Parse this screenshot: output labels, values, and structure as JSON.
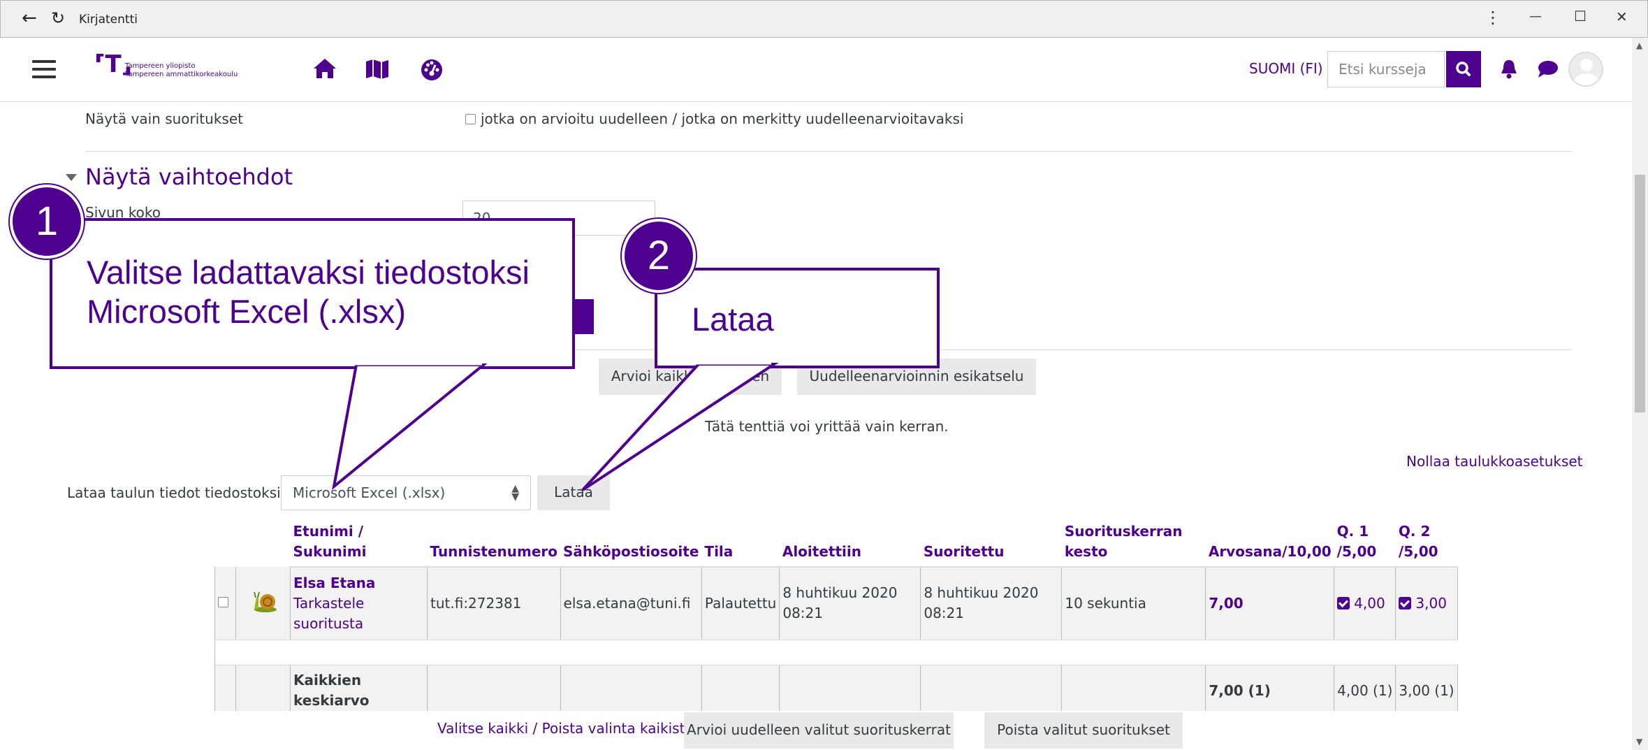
{
  "window": {
    "title": "Kirjatentti",
    "back_icon": "arrow-left-icon",
    "reload_icon": "reload-icon",
    "menu_glyph": "⋮",
    "minimize_glyph": "—",
    "maximize_glyph": "☐",
    "close_glyph": "✕"
  },
  "navbar": {
    "logo_line1": "Tampereen yliopisto",
    "logo_line2": "Tampereen ammattikorkeakoulu",
    "language": "SUOMI (FI)",
    "search_placeholder": "Etsi kursseja",
    "brand_color": "#4e008e"
  },
  "filters": {
    "show_only_label": "Näytä vain suoritukset",
    "regraded_checkbox_label": "jotka on arvioitu uudelleen / jotka on merkitty uudelleenarvioitavaksi"
  },
  "options": {
    "heading": "Näytä vaihtoehdot",
    "page_size_label": "Sivun koko",
    "page_size_value": "20"
  },
  "actions": {
    "regrade_all": "Arvioi kaikki uudelleen",
    "regrade_preview": "Uudelleenarvioinnin esikatselu",
    "attempts_info": "Tätä tenttiä voi yrittää vain kerran.",
    "reset_table": "Nollaa taulukkoasetukset",
    "download_label": "Lataa taulun tiedot tiedostoksi:",
    "download_format": "Microsoft Excel (.xlsx)",
    "download_button": "Lataa"
  },
  "table": {
    "headers": {
      "name": "Etunimi / Sukunimi",
      "idnumber": "Tunnistenumero",
      "email": "Sähköpostiosoite",
      "state": "Tila",
      "started": "Aloitettiin",
      "completed": "Suoritettu",
      "duration": "Suorituskerran kesto",
      "grade": "Arvosana/10,00",
      "q1": "Q. 1 /5,00",
      "q2": "Q. 2 /5,00"
    },
    "rows": [
      {
        "name": "Elsa Etana",
        "review": "Tarkastele suoritusta",
        "idnumber": "tut.fi:272381",
        "email": "elsa.etana@tuni.fi",
        "state": "Palautettu",
        "started": "8 huhtikuu 2020 08:21",
        "completed": "8 huhtikuu 2020 08:21",
        "duration": "10 sekuntia",
        "grade": "7,00",
        "q1": "4,00",
        "q2": "3,00"
      }
    ],
    "average": {
      "label": "Kaikkien keskiarvo",
      "grade": "7,00 (1)",
      "q1": "4,00 (1)",
      "q2": "3,00 (1)"
    }
  },
  "bottom": {
    "select_all": "Valitse kaikki / Poista valinta kaikista",
    "regrade_selected": "Arvioi uudelleen valitut suorituskerrat",
    "delete_selected": "Poista valitut suoritukset"
  },
  "callouts": [
    {
      "number": "1",
      "text": "Valitse ladattavaksi tiedostoksi Microsoft Excel (.xlsx)"
    },
    {
      "number": "2",
      "text": "Lataa"
    }
  ]
}
